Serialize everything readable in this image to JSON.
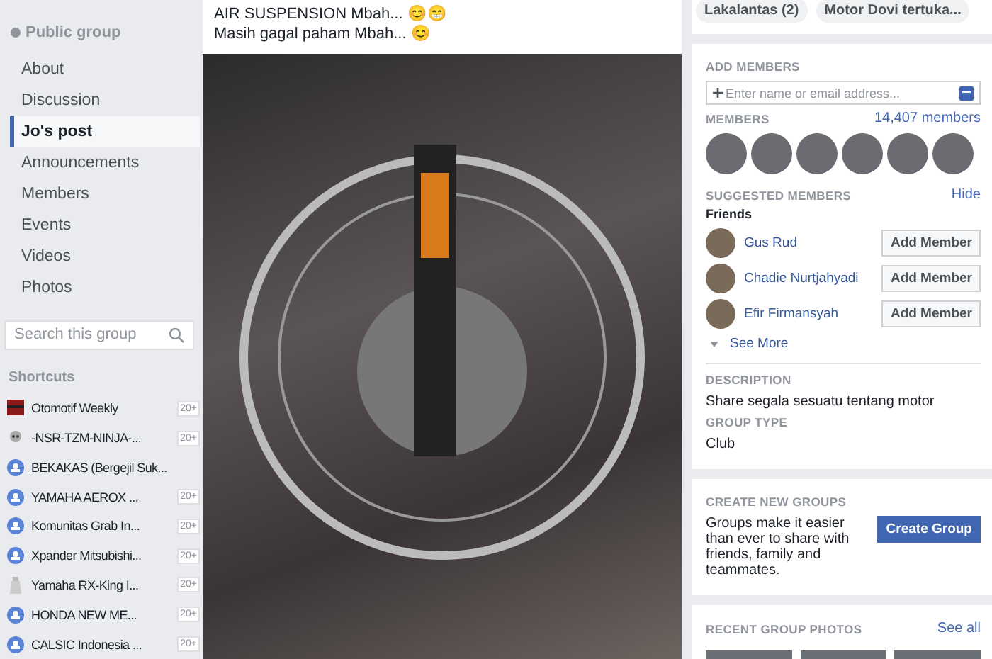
{
  "group": {
    "privacy": "Public group"
  },
  "nav": [
    {
      "label": "About",
      "selected": false
    },
    {
      "label": "Discussion",
      "selected": false
    },
    {
      "label": "Jo's post",
      "selected": true
    },
    {
      "label": "Announcements",
      "selected": false
    },
    {
      "label": "Members",
      "selected": false
    },
    {
      "label": "Events",
      "selected": false
    },
    {
      "label": "Videos",
      "selected": false
    },
    {
      "label": "Photos",
      "selected": false
    }
  ],
  "search": {
    "placeholder": "Search this group"
  },
  "shortcuts": {
    "heading": "Shortcuts",
    "items": [
      {
        "kind": "thumb",
        "name": "Otomotif Weekly",
        "badge": "20+"
      },
      {
        "kind": "skull",
        "name": "-NSR-TZM-NINJA-...",
        "badge": "20+"
      },
      {
        "kind": "group",
        "name": "BEKAKAS (Bergejil Suk..."
      },
      {
        "kind": "group",
        "name": "YAMAHA AEROX ...",
        "badge": "20+"
      },
      {
        "kind": "group",
        "name": "Komunitas Grab In...",
        "badge": "20+"
      },
      {
        "kind": "group",
        "name": "Xpander Mitsubishi...",
        "badge": "20+"
      },
      {
        "kind": "bottle",
        "name": "Yamaha RX-King I...",
        "badge": "20+"
      },
      {
        "kind": "group",
        "name": "HONDA NEW ME...",
        "badge": "20+"
      },
      {
        "kind": "group",
        "name": "CALSIC Indonesia ...",
        "badge": "20+"
      }
    ]
  },
  "post": {
    "lines": [
      "AIR SUSPENSION Mbah... 😊😁",
      "Masih gagal paham Mbah... 😊"
    ]
  },
  "tags": [
    "Lakalantas (2)",
    "Motor Dovi tertuka..."
  ],
  "add_members": {
    "heading": "ADD MEMBERS",
    "placeholder": "Enter name or email address..."
  },
  "members": {
    "heading": "MEMBERS",
    "count": "14,407 members"
  },
  "suggested": {
    "heading": "SUGGESTED MEMBERS",
    "hide": "Hide",
    "subheading": "Friends",
    "people": [
      {
        "name": "Gus Rud",
        "button": "Add Member"
      },
      {
        "name": "Chadie Nurtjahyadi",
        "button": "Add Member"
      },
      {
        "name": "Efir Firmansyah",
        "button": "Add Member"
      }
    ],
    "see_more": "See More"
  },
  "description": {
    "heading": "DESCRIPTION",
    "text": "Share segala sesuatu tentang motor"
  },
  "group_type": {
    "heading": "GROUP TYPE",
    "text": "Club"
  },
  "create": {
    "heading": "CREATE NEW GROUPS",
    "text": "Groups make it easier than ever to share with friends, family and teammates.",
    "button": "Create Group"
  },
  "recent_photos": {
    "heading": "RECENT GROUP PHOTOS",
    "link": "See all"
  }
}
